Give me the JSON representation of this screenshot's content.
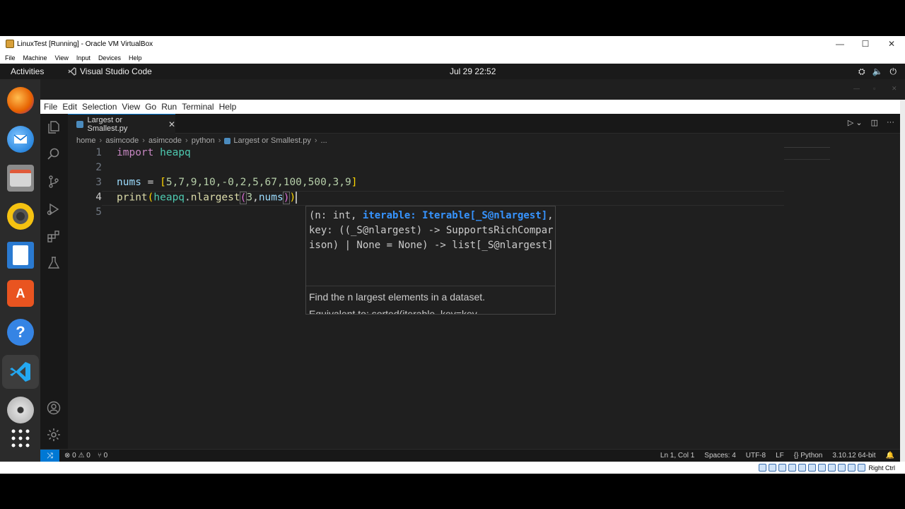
{
  "vbox": {
    "title": "LinuxTest [Running] - Oracle VM VirtualBox",
    "menu": [
      "File",
      "Machine",
      "View",
      "Input",
      "Devices",
      "Help"
    ],
    "window_controls": [
      "—",
      "☐",
      "✕"
    ],
    "host_key": "Right Ctrl"
  },
  "gnome": {
    "activities": "Activities",
    "app_name": "Visual Studio Code",
    "clock": "Jul 29  22:52"
  },
  "dock": {
    "items": [
      "firefox-icon",
      "thunderbird-icon",
      "files-icon",
      "rhythmbox-icon",
      "libreoffice-writer-icon",
      "ubuntu-software-icon",
      "help-icon",
      "vscode-icon",
      "dvd-icon",
      "show-apps-icon"
    ]
  },
  "vscode": {
    "menu": [
      "File",
      "Edit",
      "Selection",
      "View",
      "Go",
      "Run",
      "Terminal",
      "Help"
    ],
    "tab": {
      "label": "Largest or Smallest.py"
    },
    "breadcrumb": [
      "home",
      "asimcode",
      "asimcode",
      "python",
      "Largest or Smallest.py",
      "..."
    ],
    "line_numbers": [
      "1",
      "2",
      "3",
      "4",
      "5"
    ],
    "code": {
      "l1_kw": "import",
      "l1_mod": "heapq",
      "l3_var": "nums",
      "l3_eq": " = ",
      "l3_open": "[",
      "l3_vals": "5,7,9,10,-0,2,5,67,100,500,3,9",
      "l3_close": "]",
      "l4_fn": "print",
      "l4_p1": "(",
      "l4_mod": "heapq",
      "l4_dot": ".",
      "l4_fn2": "nlargest",
      "l4_p2": "(",
      "l4_num": "3",
      "l4_comma": ",",
      "l4_arg": "nums",
      "l4_p3": ")",
      "l4_p4": ")"
    },
    "hover": {
      "sig_a": "(n: int, ",
      "sig_hl": "iterable: Iterable[_S@nlargest]",
      "sig_b": ", key: ((_S@nlargest) -> SupportsRichComparison) | None = None) -> list[_S@nlargest]",
      "doc": "Find the n largest elements in a dataset.",
      "doc2": "Equivalent to: sorted(iterable, key=key,"
    },
    "status": {
      "errors": "⊗ 0 ⚠ 0",
      "ports": "⑂ 0",
      "position": "Ln 1, Col 1",
      "spaces": "Spaces: 4",
      "encoding": "UTF-8",
      "eol": "LF",
      "language": "{} Python",
      "interpreter": "3.10.12 64-bit"
    }
  }
}
